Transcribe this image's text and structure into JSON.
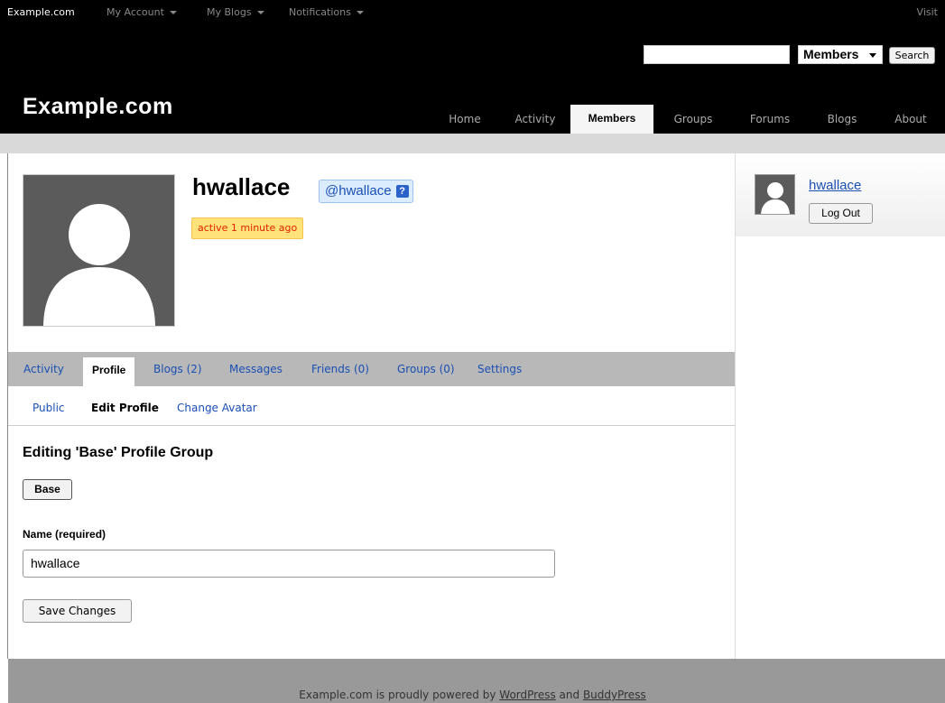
{
  "adminbar": {
    "brand": "Example.com",
    "menus": [
      "My Account",
      "My Blogs",
      "Notifications"
    ],
    "visit": "Visit"
  },
  "search": {
    "value": "",
    "scope_selected": "Members",
    "button_label": "Search"
  },
  "site": {
    "title": "Example.com"
  },
  "nav": {
    "items": [
      "Home",
      "Activity",
      "Members",
      "Groups",
      "Forums",
      "Blogs",
      "About"
    ],
    "active": "Members"
  },
  "profile": {
    "display_name": "hwallace",
    "handle": "@hwallace",
    "handle_help": "?",
    "last_active": "active 1 minute ago"
  },
  "profile_tabs": {
    "items": [
      "Activity",
      "Profile",
      "Blogs (2)",
      "Messages",
      "Friends (0)",
      "Groups (0)",
      "Settings"
    ],
    "active": "Profile"
  },
  "profile_subnav": {
    "items": [
      "Public",
      "Edit Profile",
      "Change Avatar"
    ],
    "current": "Edit Profile"
  },
  "edit_form": {
    "heading": "Editing 'Base' Profile Group",
    "group_button": "Base",
    "name_label": "Name (required)",
    "name_value": "hwallace",
    "save_label": "Save Changes"
  },
  "sidebar": {
    "username": "hwallace",
    "logout_label": "Log Out"
  },
  "footer": {
    "prefix": "Example.com is proudly powered by ",
    "link1": "WordPress",
    "middle": " and ",
    "link2": "BuddyPress"
  },
  "colors": {
    "header_bg": "#000000",
    "link": "#1a4fb4",
    "tab_bar": "#b8b8b8",
    "active_badge": "#ffe27a",
    "footer_bg": "#999999"
  }
}
